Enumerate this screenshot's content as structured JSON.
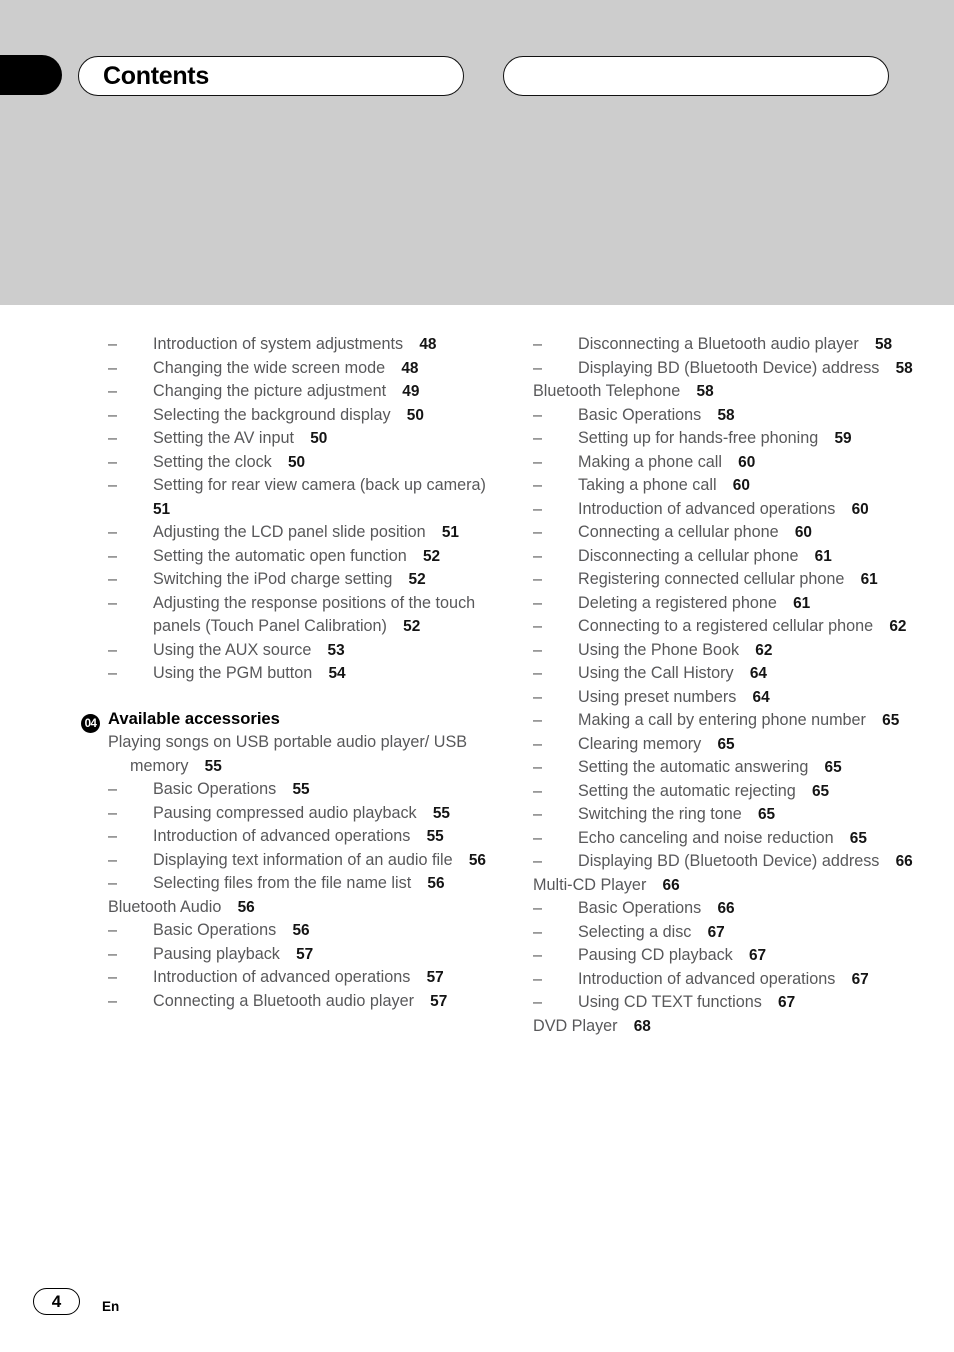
{
  "header": {
    "title": "Contents",
    "right_pill_text": ""
  },
  "footer": {
    "page_number": "4",
    "language_code": "En"
  },
  "columns": {
    "left": [
      {
        "level": 2,
        "text": "Introduction of system adjustments",
        "page": "48"
      },
      {
        "level": 2,
        "text": "Changing the wide screen mode",
        "page": "48"
      },
      {
        "level": 2,
        "text": "Changing the picture adjustment",
        "page": "49"
      },
      {
        "level": 2,
        "text": "Selecting the background display",
        "page": "50"
      },
      {
        "level": 2,
        "text": "Setting the AV input",
        "page": "50"
      },
      {
        "level": 2,
        "text": "Setting the clock",
        "page": "50"
      },
      {
        "level": 2,
        "text": "Setting for rear view camera (back up camera)",
        "page": "51"
      },
      {
        "level": 2,
        "text": "Adjusting the LCD panel slide position",
        "page": "51"
      },
      {
        "level": 2,
        "text": "Setting the automatic open function",
        "page": "52"
      },
      {
        "level": 2,
        "text": "Switching the iPod charge setting",
        "page": "52"
      },
      {
        "level": 2,
        "text": "Adjusting the response positions of the touch panels (Touch Panel Calibration)",
        "page": "52"
      },
      {
        "level": 2,
        "text": "Using the AUX source",
        "page": "53"
      },
      {
        "level": 2,
        "text": "Using the PGM button",
        "page": "54"
      },
      {
        "level": "chapter",
        "number": "04",
        "text": "Available accessories"
      },
      {
        "level": 1,
        "text": "Playing songs on USB portable audio player/ USB memory",
        "page": "55"
      },
      {
        "level": 2,
        "text": "Basic Operations",
        "page": "55"
      },
      {
        "level": 2,
        "text": "Pausing compressed audio playback",
        "page": "55"
      },
      {
        "level": 2,
        "text": "Introduction of advanced operations",
        "page": "55"
      },
      {
        "level": 2,
        "text": "Displaying text information of an audio file",
        "page": "56"
      },
      {
        "level": 2,
        "text": "Selecting files from the file name list",
        "page": "56"
      },
      {
        "level": 1,
        "text": "Bluetooth Audio",
        "page": "56"
      },
      {
        "level": 2,
        "text": "Basic Operations",
        "page": "56"
      },
      {
        "level": 2,
        "text": "Pausing playback",
        "page": "57"
      },
      {
        "level": 2,
        "text": "Introduction of advanced operations",
        "page": "57"
      },
      {
        "level": 2,
        "text": "Connecting a Bluetooth audio player",
        "page": "57"
      }
    ],
    "right": [
      {
        "level": 2,
        "text": "Disconnecting a Bluetooth audio player",
        "page": "58"
      },
      {
        "level": 2,
        "text": "Displaying BD (Bluetooth Device) address",
        "page": "58"
      },
      {
        "level": 1,
        "text": "Bluetooth Telephone",
        "page": "58"
      },
      {
        "level": 2,
        "text": "Basic Operations",
        "page": "58"
      },
      {
        "level": 2,
        "text": "Setting up for hands-free phoning",
        "page": "59"
      },
      {
        "level": 2,
        "text": "Making a phone call",
        "page": "60"
      },
      {
        "level": 2,
        "text": "Taking a phone call",
        "page": "60"
      },
      {
        "level": 2,
        "text": "Introduction of advanced operations",
        "page": "60"
      },
      {
        "level": 2,
        "text": "Connecting a cellular phone",
        "page": "60"
      },
      {
        "level": 2,
        "text": "Disconnecting a cellular phone",
        "page": "61"
      },
      {
        "level": 2,
        "text": "Registering connected cellular phone",
        "page": "61"
      },
      {
        "level": 2,
        "text": "Deleting a registered phone",
        "page": "61"
      },
      {
        "level": 2,
        "text": "Connecting to a registered cellular phone",
        "page": "62"
      },
      {
        "level": 2,
        "text": "Using the Phone Book",
        "page": "62"
      },
      {
        "level": 2,
        "text": "Using the Call History",
        "page": "64"
      },
      {
        "level": 2,
        "text": "Using preset numbers",
        "page": "64"
      },
      {
        "level": 2,
        "text": "Making a call by entering phone number",
        "page": "65"
      },
      {
        "level": 2,
        "text": "Clearing memory",
        "page": "65"
      },
      {
        "level": 2,
        "text": "Setting the automatic answering",
        "page": "65"
      },
      {
        "level": 2,
        "text": "Setting the automatic rejecting",
        "page": "65"
      },
      {
        "level": 2,
        "text": "Switching the ring tone",
        "page": "65"
      },
      {
        "level": 2,
        "text": "Echo canceling and noise reduction",
        "page": "65"
      },
      {
        "level": 2,
        "text": "Displaying BD (Bluetooth Device) address",
        "page": "66"
      },
      {
        "level": 1,
        "text": "Multi-CD Player",
        "page": "66"
      },
      {
        "level": 2,
        "text": "Basic Operations",
        "page": "66"
      },
      {
        "level": 2,
        "text": "Selecting a disc",
        "page": "67"
      },
      {
        "level": 2,
        "text": "Pausing CD playback",
        "page": "67"
      },
      {
        "level": 2,
        "text": "Introduction of advanced operations",
        "page": "67"
      },
      {
        "level": 2,
        "text": "Using CD TEXT functions",
        "page": "67"
      },
      {
        "level": 1,
        "text": "DVD Player",
        "page": "68"
      }
    ]
  },
  "icons": {
    "dash": "–"
  }
}
